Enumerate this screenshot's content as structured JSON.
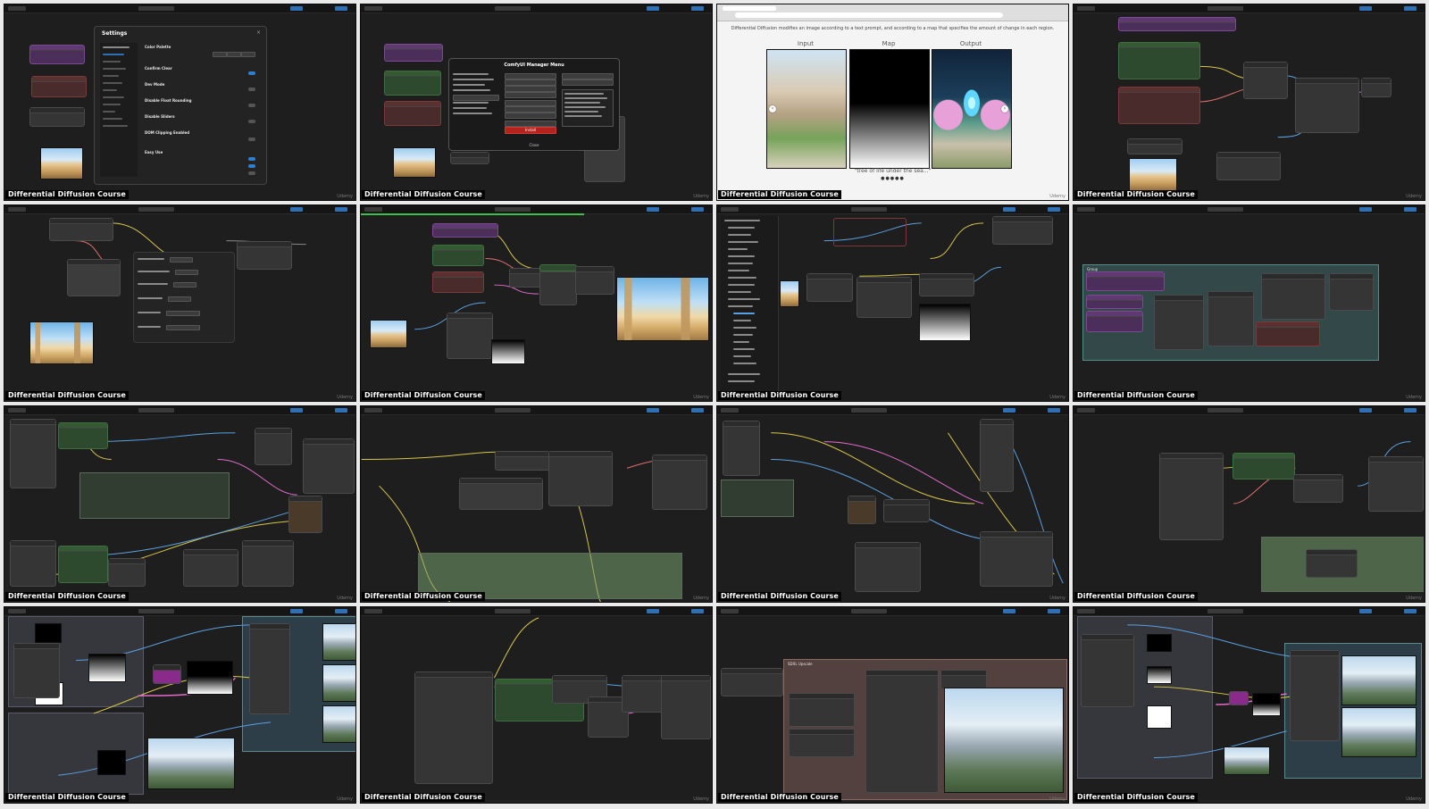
{
  "caption": "Differential Diffusion Course",
  "brand": "Udemy",
  "tiles": [
    {
      "id": 1,
      "kind": "settings"
    },
    {
      "id": 2,
      "kind": "manager"
    },
    {
      "id": 3,
      "kind": "web"
    },
    {
      "id": 4,
      "kind": "workflow"
    },
    {
      "id": 5,
      "kind": "context-menu"
    },
    {
      "id": 6,
      "kind": "workflow-preview"
    },
    {
      "id": 7,
      "kind": "node-library"
    },
    {
      "id": 8,
      "kind": "group"
    },
    {
      "id": 9,
      "kind": "workflow"
    },
    {
      "id": 10,
      "kind": "workflow"
    },
    {
      "id": 11,
      "kind": "workflow"
    },
    {
      "id": 12,
      "kind": "workflow"
    },
    {
      "id": 13,
      "kind": "workflow-outputs"
    },
    {
      "id": 14,
      "kind": "workflow"
    },
    {
      "id": 15,
      "kind": "upscale"
    },
    {
      "id": 16,
      "kind": "workflow-outputs"
    }
  ],
  "settings": {
    "title": "Settings",
    "sections": [
      "Color Palette",
      "Confirm Clear",
      "Dev Mode",
      "Disable Float Rounding",
      "Disable Sliders",
      "DOM Clipping Enabled",
      "Easy Use"
    ]
  },
  "manager": {
    "title": "ComfyUI Manager Menu",
    "install_label": "Install",
    "close_label": "Close"
  },
  "web": {
    "subtitle": "Differential Diffusion modifies an image according to a text prompt, and according to a map that specifies the amount of change in each region.",
    "col_input": "Input",
    "col_map": "Map",
    "col_output": "Output",
    "image_caption": "\"tree of life under the sea...\"",
    "dots": "●●●●●"
  },
  "nodes": {
    "sdxl_upscale_title": "SDXL Upscale",
    "group_label": "Group"
  },
  "colors": {
    "accent_blue": "#2f6fb3",
    "wire_yellow": "#d8c64a",
    "wire_blue": "#5aa0e0",
    "wire_pink": "#e06cc8",
    "node_green": "#2e4a2e",
    "node_red": "#4a2b2b",
    "node_purple": "#4b2f5a"
  }
}
